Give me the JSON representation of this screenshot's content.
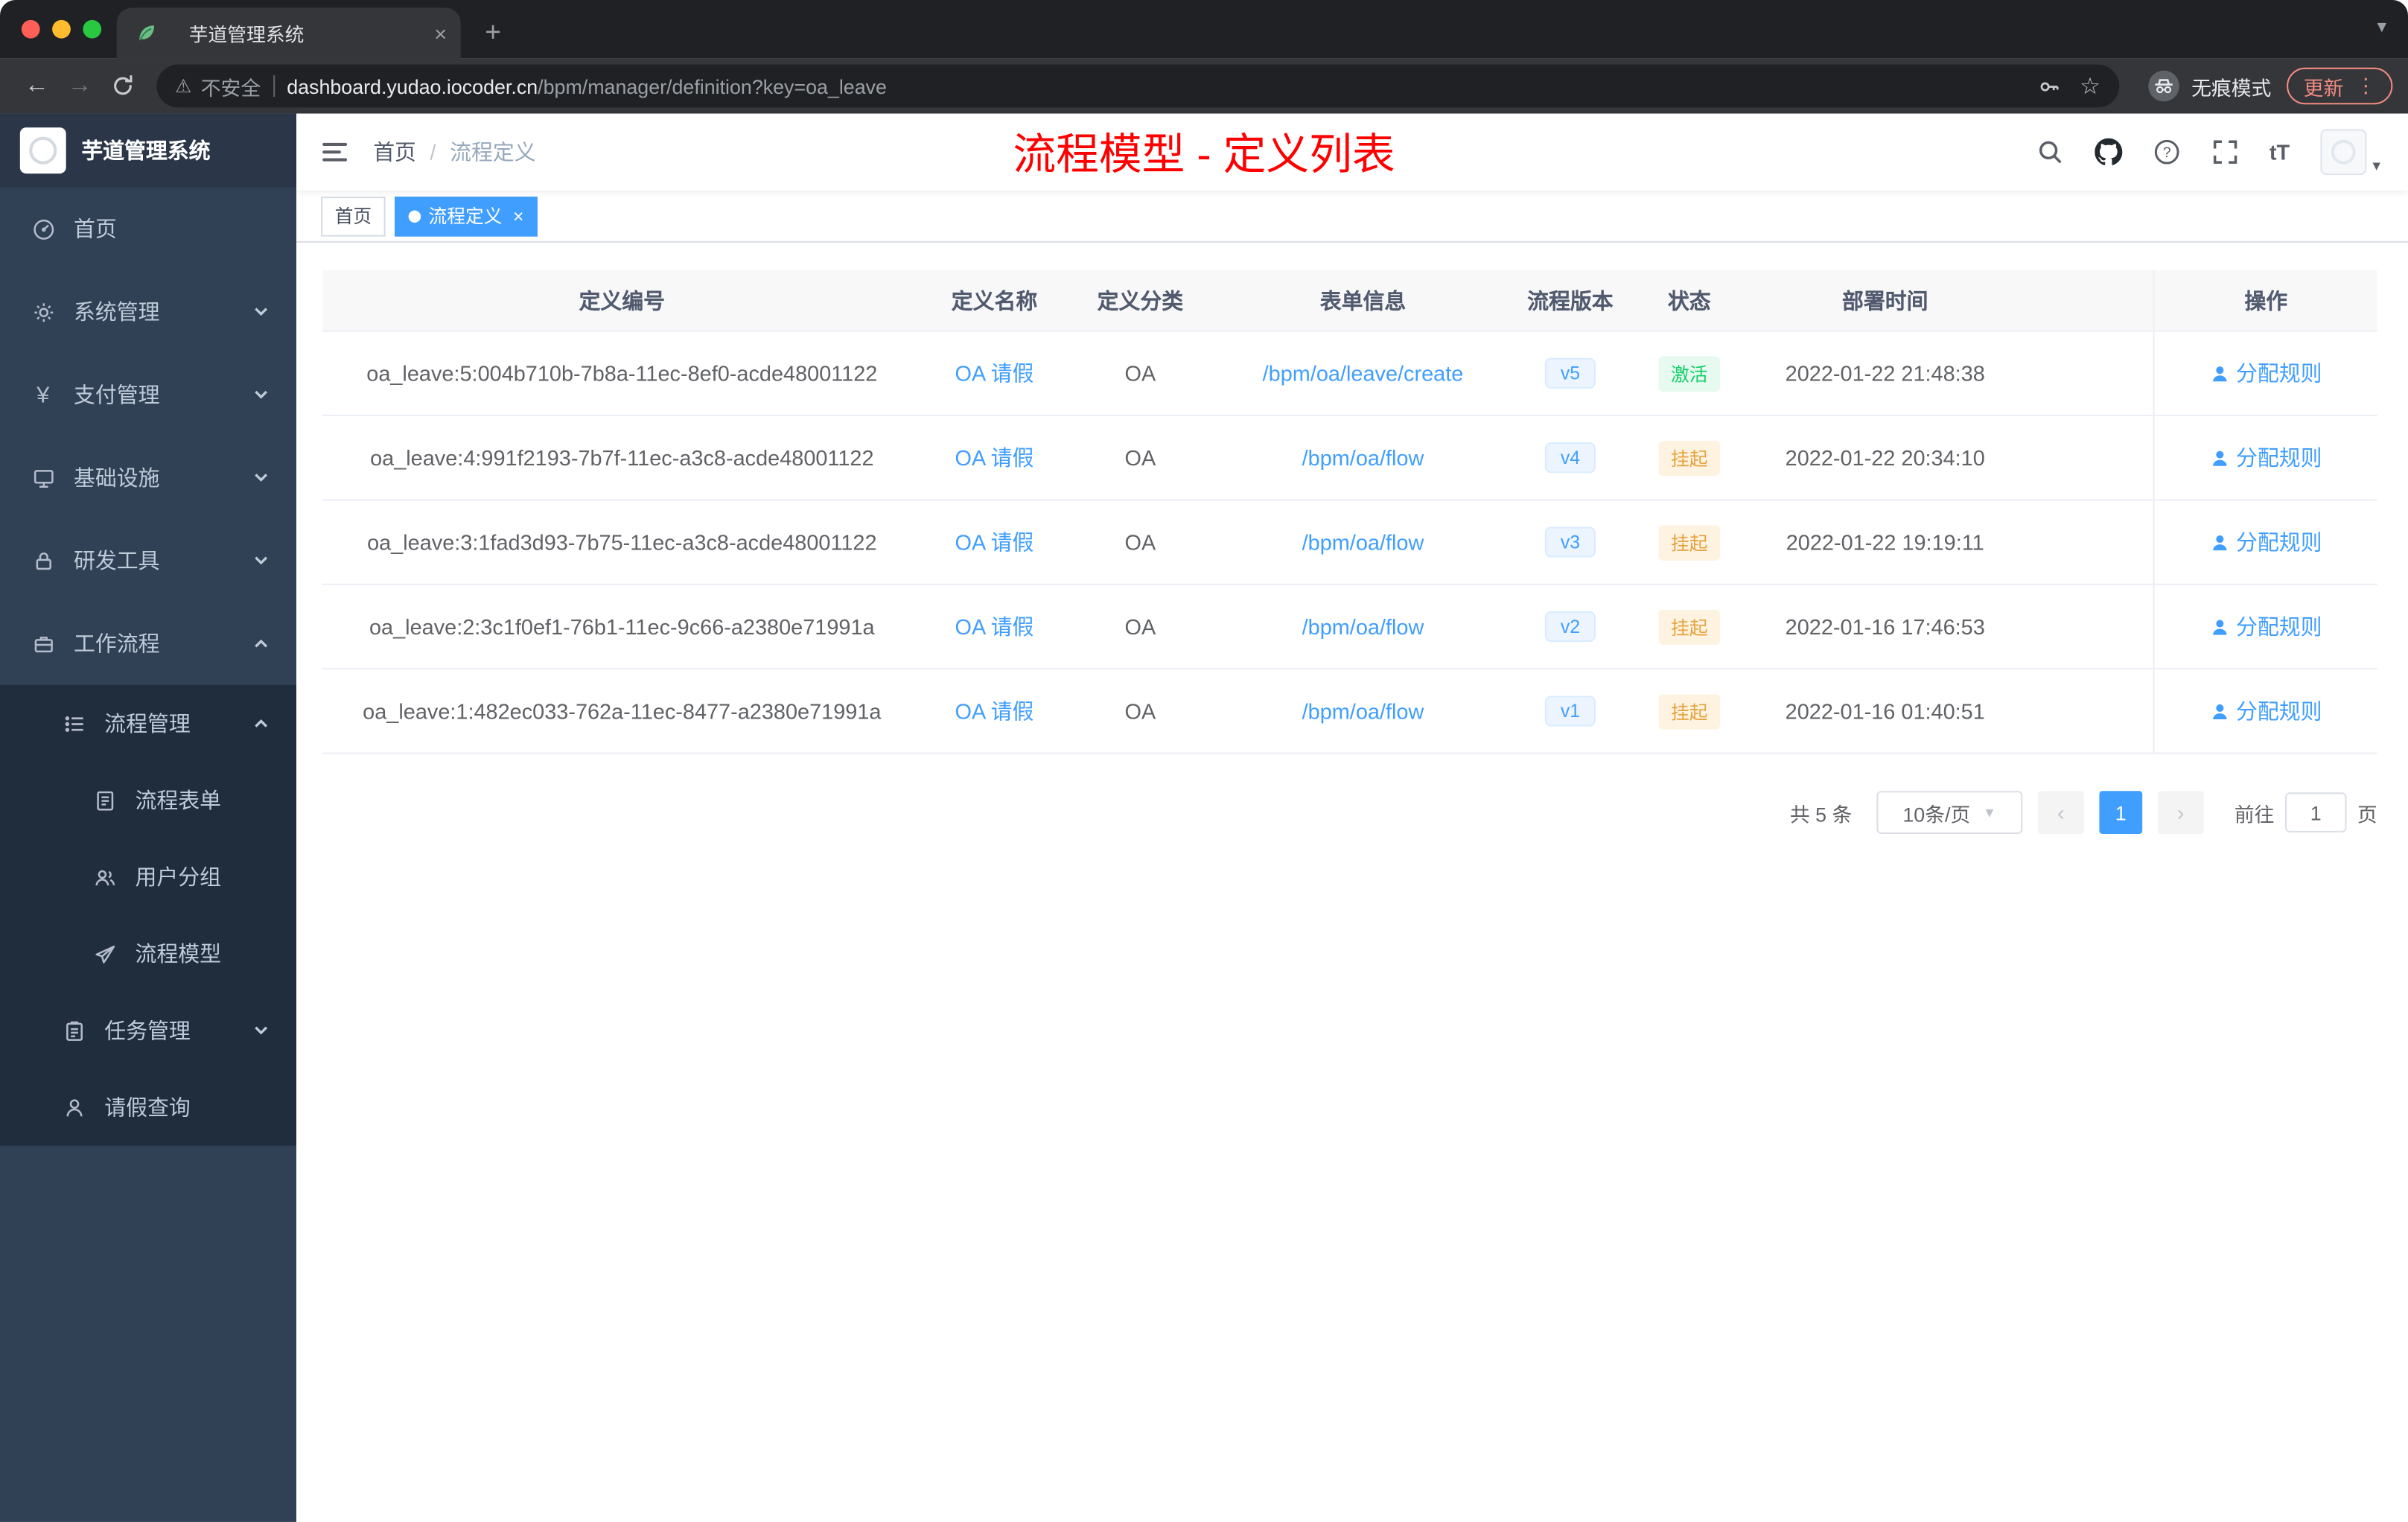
{
  "colors": {
    "accent": "#409eff",
    "success": "#13ce66",
    "warning": "#e6a23c",
    "annotation_red": "#fe0000",
    "sidebar_bg": "#304156",
    "submenu_bg": "#1f2d3d"
  },
  "browser": {
    "tab_title": "芋道管理系统",
    "close_tab": "×",
    "new_tab": "+",
    "tab_caret": "▾",
    "back": "←",
    "forward": "→",
    "warning": "⚠",
    "security_label": "不安全",
    "url_domain": "dashboard.yudao.iocoder.cn",
    "url_path": "/bpm/manager/definition?key=oa_leave",
    "star": "☆",
    "incognito_label": "无痕模式",
    "update_label": "更新",
    "menu_dots": "⋮",
    "icons": {
      "favicon": "leaf",
      "reload": "reload",
      "key": "key",
      "incognito": "incognito"
    }
  },
  "sidebar": {
    "app_title": "芋道管理系统",
    "items": [
      {
        "label": "首页",
        "icon": "gauge"
      },
      {
        "label": "系统管理",
        "icon": "gear"
      },
      {
        "label": "支付管理",
        "icon": "yen"
      },
      {
        "label": "基础设施",
        "icon": "infra"
      },
      {
        "label": "研发工具",
        "icon": "tool"
      },
      {
        "label": "工作流程",
        "icon": "workflow",
        "children": [
          {
            "label": "流程管理",
            "icon": "list",
            "children": [
              {
                "label": "流程表单",
                "icon": "form"
              },
              {
                "label": "用户分组",
                "icon": "users"
              },
              {
                "label": "流程模型",
                "icon": "send"
              }
            ]
          },
          {
            "label": "任务管理",
            "icon": "task"
          },
          {
            "label": "请假查询",
            "icon": "user"
          }
        ]
      }
    ]
  },
  "navbar": {
    "breadcrumb_home": "首页",
    "breadcrumb_sep": "/",
    "breadcrumb_current": "流程定义",
    "annotation": "流程模型 - 定义列表",
    "font_icon_label": "tT",
    "avatar_caret": "▾",
    "icons": {
      "hamburger": "hamburger",
      "search": "search",
      "github": "github",
      "help": "question",
      "fullscreen": "fullscreen"
    }
  },
  "tags": {
    "home": "首页",
    "current": "流程定义",
    "close": "×"
  },
  "table": {
    "columns": [
      "定义编号",
      "定义名称",
      "定义分类",
      "表单信息",
      "流程版本",
      "状态",
      "部署时间",
      "操作"
    ],
    "action_icon": "user-filled",
    "rows": [
      {
        "id": "oa_leave:5:004b710b-7b8a-11ec-8ef0-acde48001122",
        "name": "OA 请假",
        "category": "OA",
        "form": "/bpm/oa/leave/create",
        "version": "v5",
        "status": "激活",
        "deploy_time": "2022-01-22 21:48:38",
        "action": "分配规则"
      },
      {
        "id": "oa_leave:4:991f2193-7b7f-11ec-a3c8-acde48001122",
        "name": "OA 请假",
        "category": "OA",
        "form": "/bpm/oa/flow",
        "version": "v4",
        "status": "挂起",
        "deploy_time": "2022-01-22 20:34:10",
        "action": "分配规则"
      },
      {
        "id": "oa_leave:3:1fad3d93-7b75-11ec-a3c8-acde48001122",
        "name": "OA 请假",
        "category": "OA",
        "form": "/bpm/oa/flow",
        "version": "v3",
        "status": "挂起",
        "deploy_time": "2022-01-22 19:19:11",
        "action": "分配规则"
      },
      {
        "id": "oa_leave:2:3c1f0ef1-76b1-11ec-9c66-a2380e71991a",
        "name": "OA 请假",
        "category": "OA",
        "form": "/bpm/oa/flow",
        "version": "v2",
        "status": "挂起",
        "deploy_time": "2022-01-16 17:46:53",
        "action": "分配规则"
      },
      {
        "id": "oa_leave:1:482ec033-762a-11ec-8477-a2380e71991a",
        "name": "OA 请假",
        "category": "OA",
        "form": "/bpm/oa/flow",
        "version": "v1",
        "status": "挂起",
        "deploy_time": "2022-01-16 01:40:51",
        "action": "分配规则"
      }
    ]
  },
  "pagination": {
    "total": "共 5 条",
    "page_size": "10条/页",
    "prev": "‹",
    "page": "1",
    "next": "›",
    "goto_label": "前往",
    "goto_value": "1",
    "goto_suffix": "页"
  }
}
